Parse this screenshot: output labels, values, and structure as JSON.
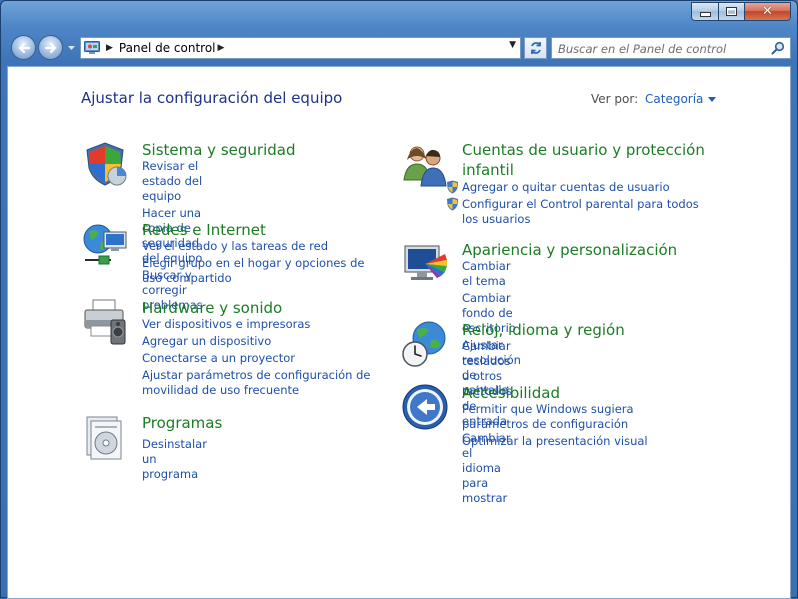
{
  "window": {
    "caption": {
      "minimize": "minimize",
      "maximize": "maximize",
      "close": "✕"
    }
  },
  "address_bar": {
    "breadcrumb": "Panel de control",
    "separator": "▶",
    "dropdown": "▼"
  },
  "search": {
    "placeholder": "Buscar en el Panel de control"
  },
  "header": {
    "title": "Ajustar la configuración del equipo",
    "view_by_label": "Ver por:",
    "view_by_value": "Categoría"
  },
  "categories": [
    {
      "title": "Sistema y seguridad",
      "icon": "shield-icon",
      "links": [
        "Revisar el estado del equipo",
        "Hacer una copia de seguridad del equipo",
        "Buscar y corregir problemas"
      ]
    },
    {
      "title": "Redes e Internet",
      "icon": "network-globe-icon",
      "links": [
        "Ver el estado y las tareas de red",
        "Elegir grupo en el hogar y opciones de uso compartido"
      ]
    },
    {
      "title": "Hardware y sonido",
      "icon": "printer-speaker-icon",
      "links": [
        "Ver dispositivos e impresoras",
        "Agregar un dispositivo",
        "Conectarse a un proyector",
        "Ajustar parámetros de configuración de movilidad de uso frecuente"
      ]
    },
    {
      "title": "Programas",
      "icon": "programs-icon",
      "links": [
        "Desinstalar un programa"
      ]
    },
    {
      "title": "Cuentas de usuario y protección infantil",
      "icon": "users-icon",
      "links": [
        "Agregar o quitar cuentas de usuario",
        "Configurar el Control parental para todos los usuarios"
      ]
    },
    {
      "title": "Apariencia y personalización",
      "icon": "monitor-palette-icon",
      "links": [
        "Cambiar el tema",
        "Cambiar fondo de escritorio",
        "Ajustar resolución de pantalla"
      ]
    },
    {
      "title": "Reloj, idioma y región",
      "icon": "clock-globe-icon",
      "links": [
        "Cambiar teclados u otros métodos de entrada",
        "Cambiar el idioma para mostrar"
      ]
    },
    {
      "title": "Accesibilidad",
      "icon": "accessibility-icon",
      "links": [
        "Permitir que Windows sugiera parámetros de configuración",
        "Optimizar la presentación visual"
      ]
    }
  ],
  "colors": {
    "title_blue": "#1e3287",
    "category_green": "#1c7c25",
    "link_blue": "#1e4fa8",
    "frame_blue": "#3a6fb0"
  }
}
